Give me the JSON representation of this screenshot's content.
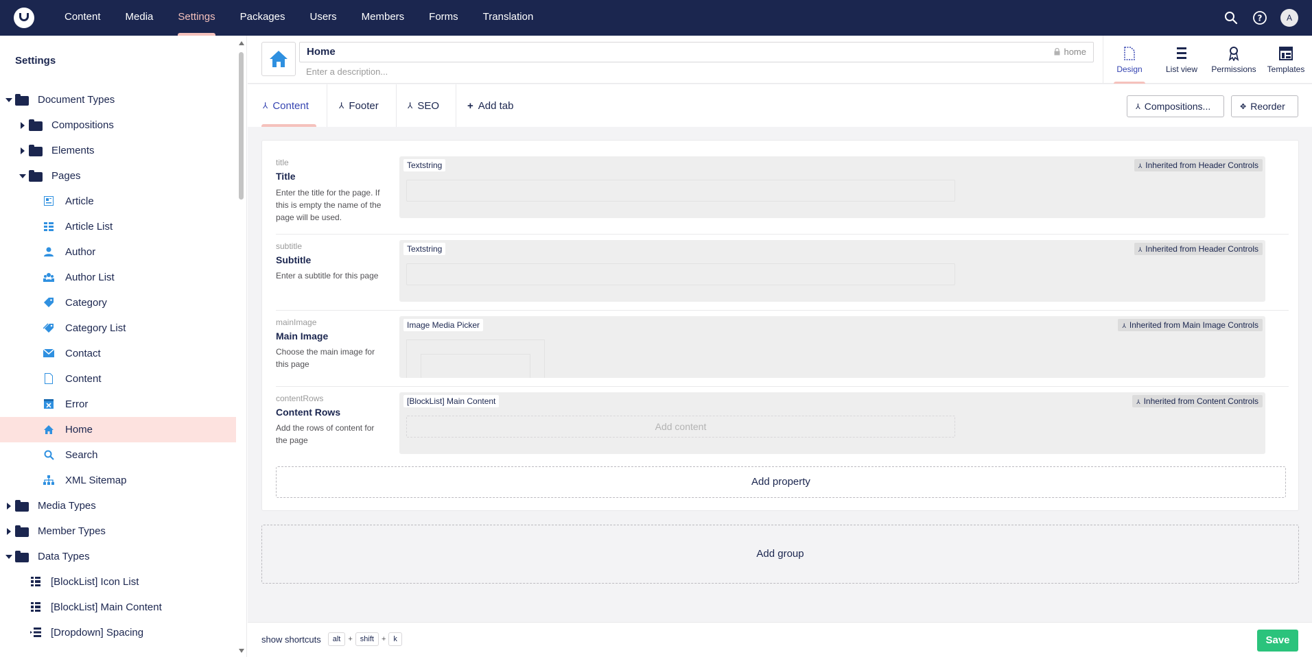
{
  "topnav": {
    "items": [
      "Content",
      "Media",
      "Settings",
      "Packages",
      "Users",
      "Members",
      "Forms",
      "Translation"
    ],
    "active": "Settings",
    "avatar_initial": "A",
    "icons": [
      "umbraco-logo-icon",
      "search-icon",
      "help-icon"
    ]
  },
  "sidebar": {
    "title": "Settings",
    "items": [
      {
        "label": "Document Types",
        "icon": "folder-icon",
        "caret": "down"
      },
      {
        "label": "Compositions",
        "icon": "folder-icon",
        "caret": "right"
      },
      {
        "label": "Elements",
        "icon": "folder-icon",
        "caret": "right"
      },
      {
        "label": "Pages",
        "icon": "folder-icon",
        "caret": "down"
      },
      {
        "label": "Article",
        "icon": "article-icon"
      },
      {
        "label": "Article List",
        "icon": "list-icon"
      },
      {
        "label": "Author",
        "icon": "user-icon"
      },
      {
        "label": "Author List",
        "icon": "users-icon"
      },
      {
        "label": "Category",
        "icon": "tag-icon"
      },
      {
        "label": "Category List",
        "icon": "tags-icon"
      },
      {
        "label": "Contact",
        "icon": "envelope-icon"
      },
      {
        "label": "Content",
        "icon": "document-icon"
      },
      {
        "label": "Error",
        "icon": "error-icon"
      },
      {
        "label": "Home",
        "icon": "home-icon",
        "active": true
      },
      {
        "label": "Search",
        "icon": "search-icon"
      },
      {
        "label": "XML Sitemap",
        "icon": "sitemap-icon"
      },
      {
        "label": "Media Types",
        "icon": "folder-icon",
        "caret": "right"
      },
      {
        "label": "Member Types",
        "icon": "folder-icon",
        "caret": "right"
      },
      {
        "label": "Data Types",
        "icon": "folder-icon",
        "caret": "down"
      },
      {
        "label": "[BlockList] Icon List",
        "icon": "blocklist-icon"
      },
      {
        "label": "[BlockList] Main Content",
        "icon": "blocklist-icon"
      },
      {
        "label": "[Dropdown] Spacing",
        "icon": "dropdown-icon"
      }
    ]
  },
  "header": {
    "name": "Home",
    "alias": "home",
    "description_placeholder": "Enter a description...",
    "actions": [
      {
        "label": "Design",
        "icon": "document-outline-icon",
        "active": true
      },
      {
        "label": "List view",
        "icon": "list-view-icon"
      },
      {
        "label": "Permissions",
        "icon": "permissions-icon"
      },
      {
        "label": "Templates",
        "icon": "templates-icon"
      }
    ]
  },
  "tabs": {
    "items": [
      "Content",
      "Footer",
      "SEO"
    ],
    "active": "Content",
    "add_tab": "Add tab",
    "compositions": "Compositions...",
    "reorder": "Reorder"
  },
  "properties": [
    {
      "alias": "title",
      "name": "Title",
      "description": "Enter the title for the page. If this is empty the name of the page will be used.",
      "editor": "Textstring",
      "inherited": "Inherited from Header Controls"
    },
    {
      "alias": "subtitle",
      "name": "Subtitle",
      "description": "Enter a subtitle for this page",
      "editor": "Textstring",
      "inherited": "Inherited from Header Controls"
    },
    {
      "alias": "mainImage",
      "name": "Main Image",
      "description": "Choose the main image for this page",
      "editor": "Image Media Picker",
      "inherited": "Inherited from Main Image Controls"
    },
    {
      "alias": "contentRows",
      "name": "Content Rows",
      "description": "Add the rows of content for the page",
      "editor": "[BlockList] Main Content",
      "inherited": "Inherited from Content Controls",
      "add_content": "Add content"
    }
  ],
  "add_property": "Add property",
  "add_group": "Add group",
  "footer": {
    "shortcuts_label": "show shortcuts",
    "keys": [
      "alt",
      "shift",
      "k"
    ],
    "plus": "+",
    "save": "Save"
  },
  "colors": {
    "topbar": "#1b264f",
    "active_accent": "#f5c1bc",
    "selected_row": "#fde2df",
    "icon_blue": "#2f90e0",
    "save_green": "#2bc37c"
  }
}
